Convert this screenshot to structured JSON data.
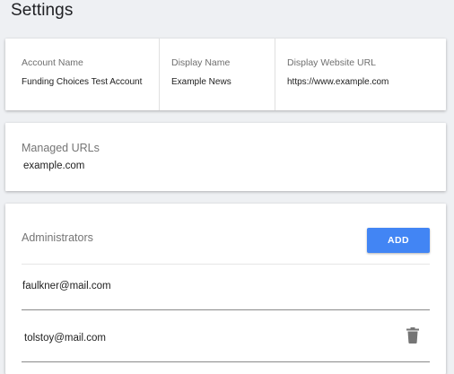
{
  "page": {
    "title": "Settings"
  },
  "account": {
    "account_name_label": "Account Name",
    "account_name_value": "Funding Choices Test Account",
    "display_name_label": "Display Name",
    "display_name_value": "Example News",
    "display_url_label": "Display Website URL",
    "display_url_value": "https://www.example.com"
  },
  "managed_urls": {
    "label": "Managed URLs",
    "items": [
      "example.com"
    ]
  },
  "administrators": {
    "label": "Administrators",
    "add_label": "ADD",
    "items": [
      {
        "email": "faulkner@mail.com",
        "deletable": false
      },
      {
        "email": "tolstoy@mail.com",
        "deletable": true,
        "icon": "trash-icon"
      }
    ]
  },
  "colors": {
    "accent": "#4285f4",
    "background": "#eef0f3",
    "card": "#ffffff",
    "label": "#757575"
  }
}
